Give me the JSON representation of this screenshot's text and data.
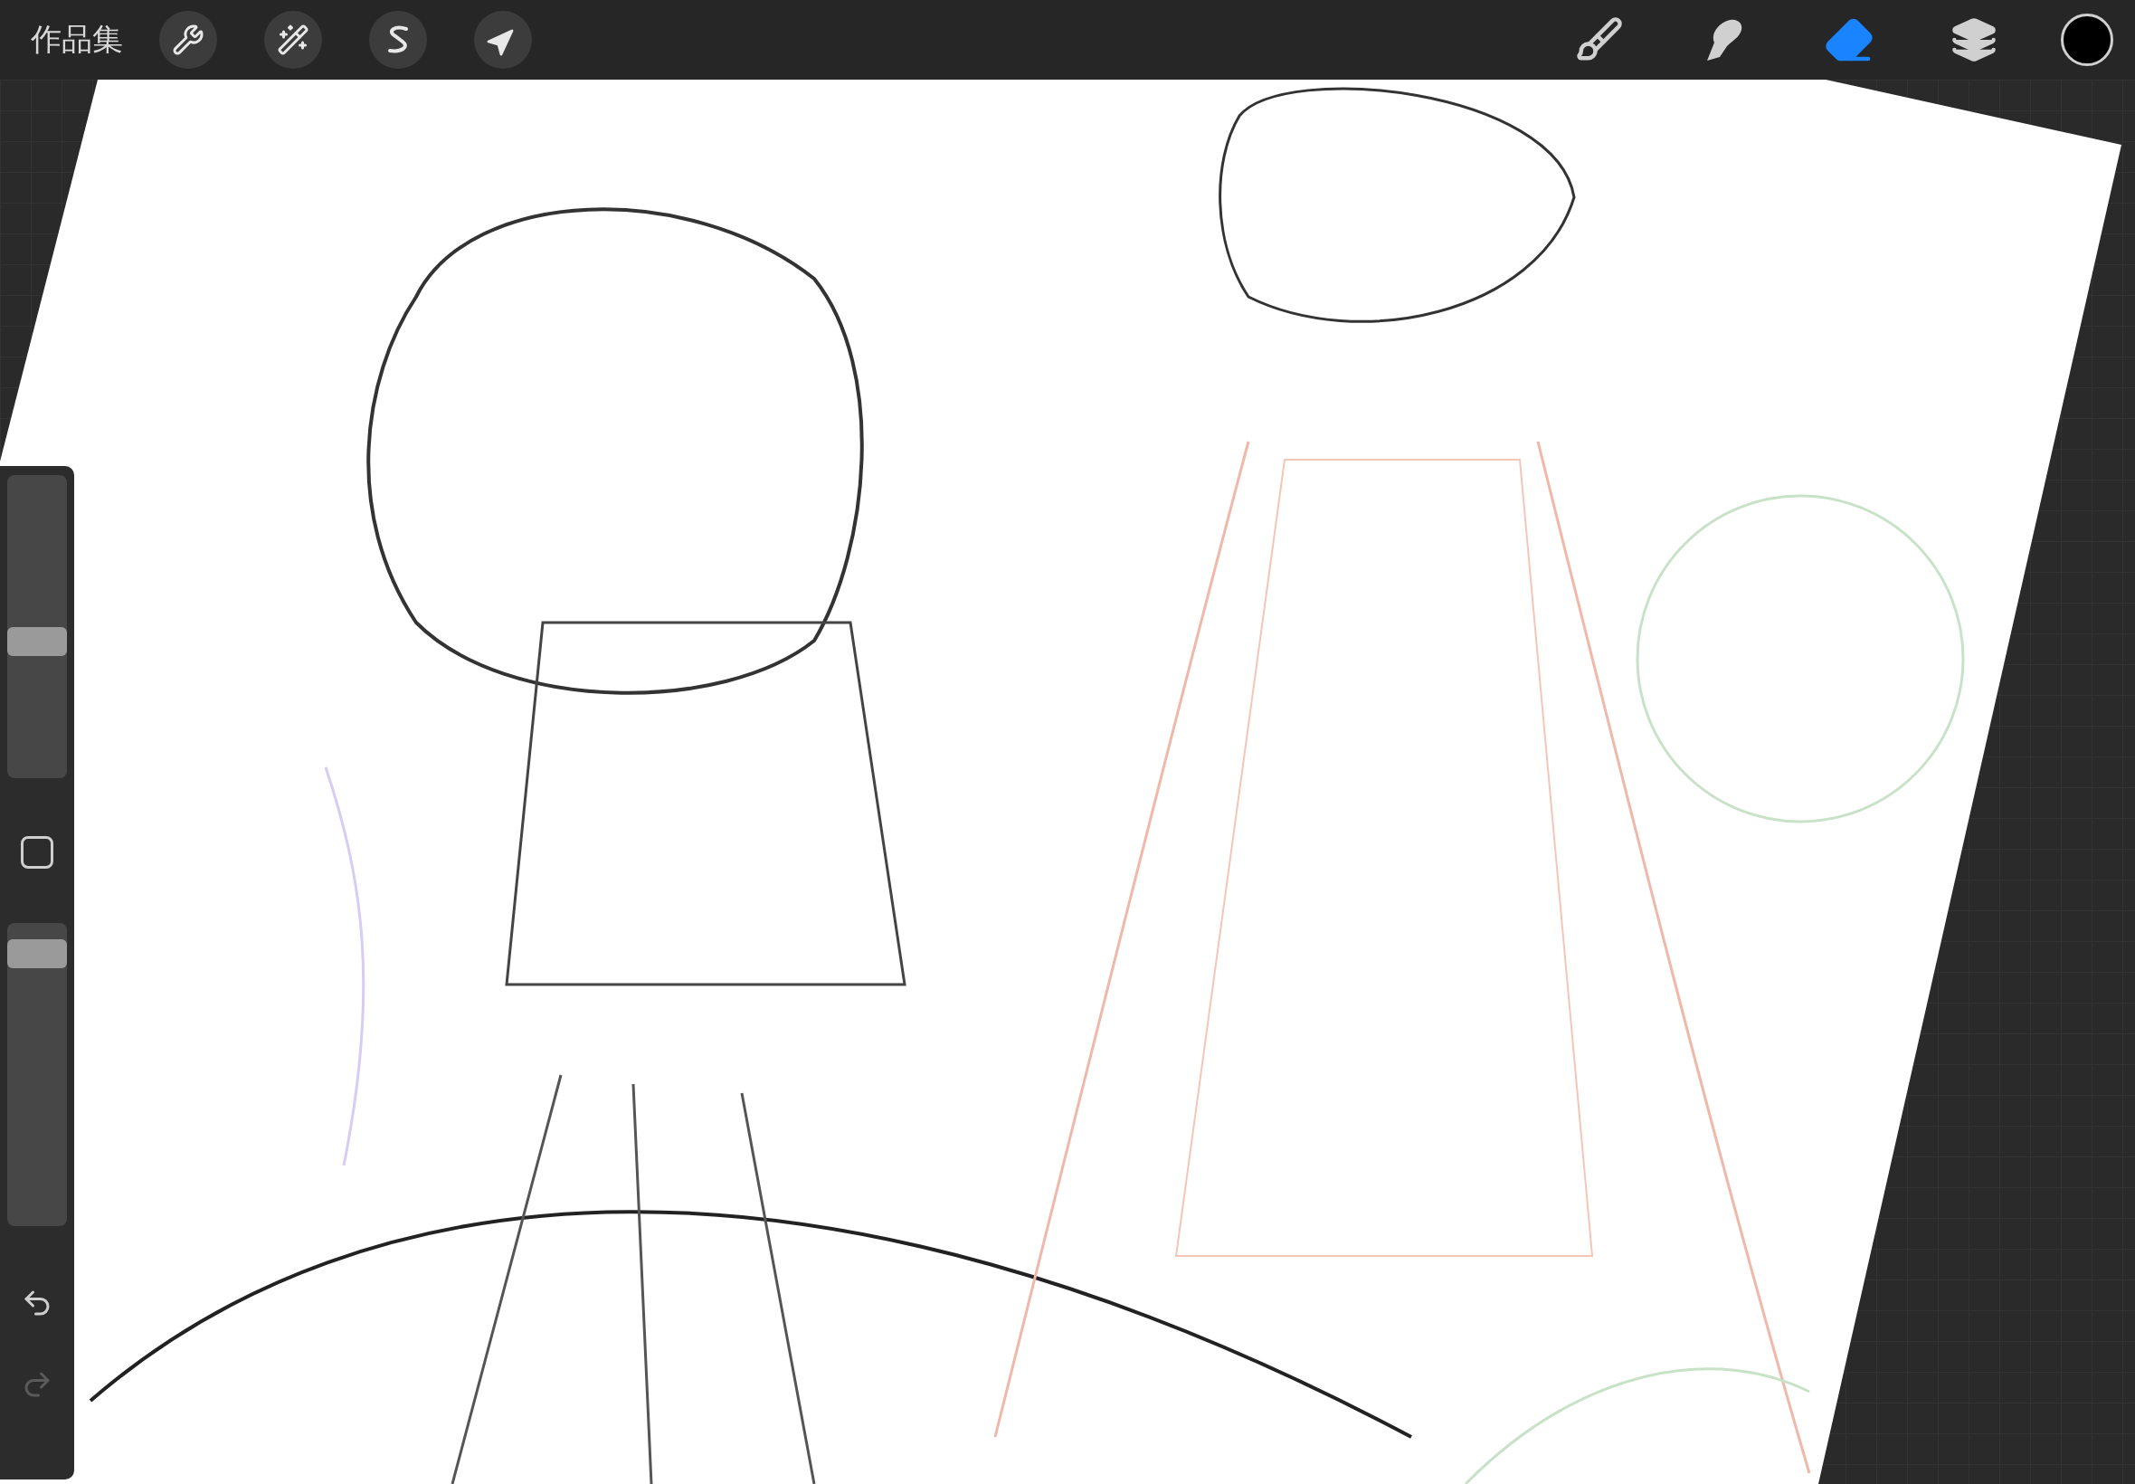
{
  "top_bar": {
    "gallery_label": "作品集",
    "left_tools": [
      {
        "kind": "wrench",
        "selected": false
      },
      {
        "kind": "wand",
        "selected": false
      },
      {
        "kind": "selection",
        "selected": false
      },
      {
        "kind": "move",
        "selected": false
      }
    ],
    "right_tools": [
      {
        "kind": "brush",
        "selected": false
      },
      {
        "kind": "smudge",
        "selected": false
      },
      {
        "kind": "eraser",
        "selected": true
      },
      {
        "kind": "layers",
        "selected": false
      }
    ],
    "color_swatch": {
      "color": "#000000"
    }
  },
  "sidebar": {
    "brush_size": {
      "level": 0.45
    },
    "opacity": {
      "level": 0.9
    },
    "undo": {
      "disabled": false
    },
    "redo": {
      "disabled": true
    }
  }
}
